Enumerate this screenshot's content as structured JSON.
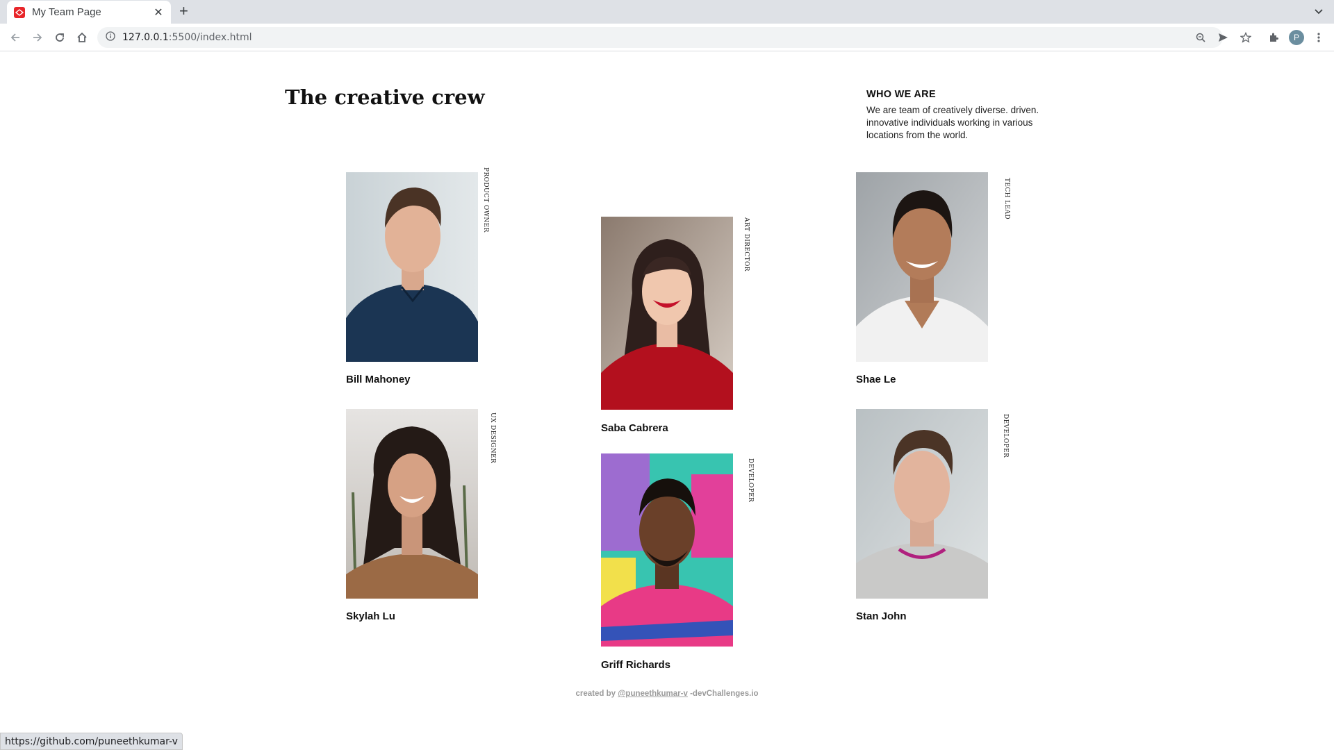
{
  "browser": {
    "tab_title": "My Team Page",
    "url_host": "127.0.0.1",
    "url_rest": ":5500/index.html",
    "profile_initial": "P",
    "status_url": "https://github.com/puneethkumar-v"
  },
  "page": {
    "title": "The creative crew",
    "about_heading": "WHO WE ARE",
    "about_text": "We are team of creatively diverse. driven. innovative individuals working in various locations from the world."
  },
  "members": [
    {
      "name": "Bill Mahoney",
      "role": "PRODUCT OWNER",
      "photo": "man-dark-polo-portrait"
    },
    {
      "name": "Saba Cabrera",
      "role": "ART DIRECTOR",
      "photo": "woman-red-sweater-portrait"
    },
    {
      "name": "Shae Le",
      "role": "TECH LEAD",
      "photo": "man-white-tshirt-portrait"
    },
    {
      "name": "Skylah Lu",
      "role": "UX DESIGNER",
      "photo": "woman-leopard-top-portrait"
    },
    {
      "name": "Griff Richards",
      "role": "DEVELOPER",
      "photo": "man-colorful-wall-portrait"
    },
    {
      "name": "Stan John",
      "role": "DEVELOPER",
      "photo": "man-grey-sweater-portrait"
    }
  ],
  "footer": {
    "prefix": "created by",
    "author": "@puneethkumar-v",
    "suffix": "-devChallenges.io"
  },
  "colors": {
    "favicon": "#e8262a",
    "text": "#111111",
    "footer": "#9a9a9a"
  }
}
